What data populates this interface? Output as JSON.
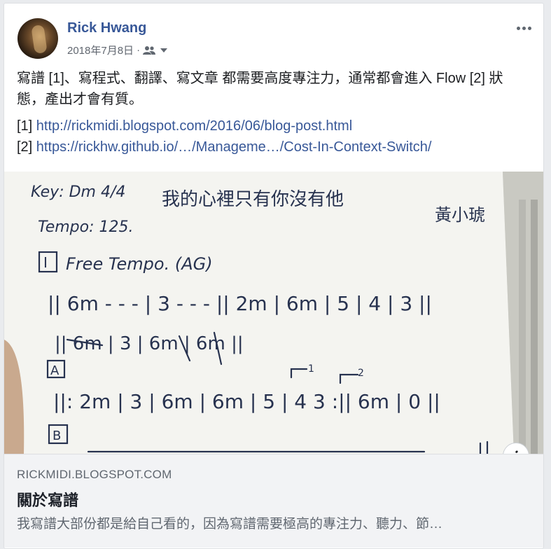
{
  "post": {
    "author": "Rick Hwang",
    "date": "2018年7月8日",
    "separator": "·",
    "audience_icon": "friends-icon",
    "text_paragraph": "寫譜 [1]、寫程式、翻譯、寫文章 都需要高度專注力，通常都會進入 Flow [2] 狀態，產出才會有質。",
    "ref1_label": "[1] ",
    "ref1_link": "http://rickmidi.blogspot.com/2016/06/blog-post.html",
    "ref2_label": "[2] ",
    "ref2_link": "https://rickhw.github.io/…/Manageme…/Cost-In-Context-Switch/"
  },
  "photo": {
    "sheet_lines": {
      "key": "Key: Dm 4/4",
      "title": "我的心裡只有你沒有他",
      "composer": "黃小琥",
      "tempo": "Tempo: 125.",
      "section_i": "Free Tempo. (AG)",
      "line1": "|| 6m - - - | 3 - - - || 2m | 6m | 5 | 4 | 3 ||",
      "line2": "|| 6m | 3 | 6m | 6m ||",
      "line3": "||: 2m | 3 | 6m | 6m | 5 | 4 3 :|| 6m | 0 ||",
      "sec_roman": "I",
      "sec_a": "A",
      "sec_b": "B",
      "ending1": "1",
      "ending2": "2"
    }
  },
  "link_preview": {
    "domain": "RICKMIDI.BLOGSPOT.COM",
    "title": "關於寫譜",
    "description": "我寫譜大部份都是給自己看的，因為寫譜需要極高的專注力、聽力、節…",
    "info_glyph": "i"
  },
  "colors": {
    "link": "#385898",
    "text": "#1c1e21",
    "secondary": "#606770"
  }
}
